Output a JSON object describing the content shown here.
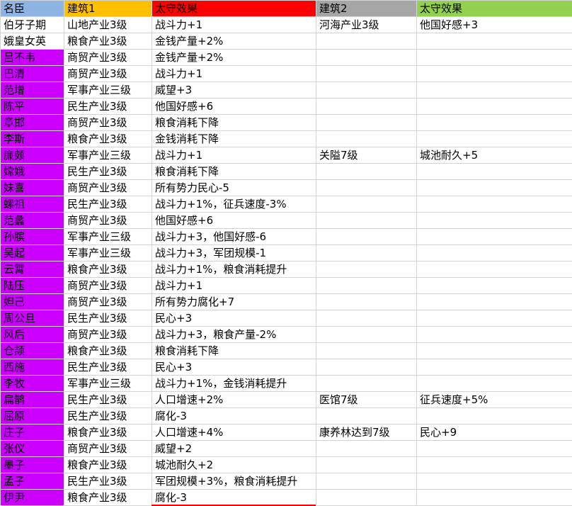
{
  "headers": [
    "名臣",
    "建筑1",
    "太守效果",
    "建筑2",
    "太守效果"
  ],
  "colors": {
    "header_name": "#8db4e2",
    "header_building1": "#ffc000",
    "header_effect1": "#ff0000",
    "header_building2": "#a6a6a6",
    "header_effect2": "#92d050",
    "name_highlight": "#cc00ff"
  },
  "rows": [
    {
      "name": "伯牙子期",
      "b1": "山地产业3级",
      "e1": "战斗力+1",
      "b2": "河海产业3级",
      "e2": "他国好感+3"
    },
    {
      "name": "娥皇女英",
      "b1": "粮食产业3级",
      "e1": "金钱产量+2%",
      "b2": "",
      "e2": ""
    },
    {
      "name": "吕不韦",
      "b1": "商贸产业3级",
      "e1": "金钱产量+2%",
      "b2": "",
      "e2": ""
    },
    {
      "name": "巴清",
      "b1": "商贸产业3级",
      "e1": "战斗力+1",
      "b2": "",
      "e2": ""
    },
    {
      "name": "范增",
      "b1": "军事产业三级",
      "e1": "威望+3",
      "b2": "",
      "e2": ""
    },
    {
      "name": "陈平",
      "b1": "民生产业3级",
      "e1": "他国好感+6",
      "b2": "",
      "e2": ""
    },
    {
      "name": "章邯",
      "b1": "商贸产业3级",
      "e1": "粮食消耗下降",
      "b2": "",
      "e2": ""
    },
    {
      "name": "李斯",
      "b1": "粮食产业3级",
      "e1": "金钱消耗下降",
      "b2": "",
      "e2": ""
    },
    {
      "name": "廉颇",
      "b1": "军事产业三级",
      "e1": "战斗力+1",
      "b2": "关隘7级",
      "e2": "城池耐久+5"
    },
    {
      "name": "嫦娥",
      "b1": "民生产业3级",
      "e1": "粮食消耗下降",
      "b2": "",
      "e2": ""
    },
    {
      "name": "妹喜",
      "b1": "商贸产业3级",
      "e1": "所有势力民心-5",
      "b2": "",
      "e2": ""
    },
    {
      "name": "螺祖",
      "b1": "民生产业3级",
      "e1": "战斗力+1%，征兵速度-3%",
      "b2": "",
      "e2": ""
    },
    {
      "name": "范蠡",
      "b1": "商贸产业3级",
      "e1": "他国好感+6",
      "b2": "",
      "e2": ""
    },
    {
      "name": "孙膑",
      "b1": "军事产业三级",
      "e1": "战斗力+3，他国好感-6",
      "b2": "",
      "e2": ""
    },
    {
      "name": "吴起",
      "b1": "军事产业三级",
      "e1": "战斗力+3，军团规模-1",
      "b2": "",
      "e2": ""
    },
    {
      "name": "云霄",
      "b1": "粮食产业3级",
      "e1": "战斗力+1%，粮食消耗提升",
      "b2": "",
      "e2": ""
    },
    {
      "name": "陆压",
      "b1": "商贸产业3级",
      "e1": "战斗力+1",
      "b2": "",
      "e2": ""
    },
    {
      "name": "妲己",
      "b1": "商贸产业3级",
      "e1": "所有势力腐化+7",
      "b2": "",
      "e2": ""
    },
    {
      "name": "周公旦",
      "b1": "民生产业3级",
      "e1": "民心+3",
      "b2": "",
      "e2": ""
    },
    {
      "name": "风后",
      "b1": "商贸产业3级",
      "e1": "战斗力+3，粮食产量-2%",
      "b2": "",
      "e2": ""
    },
    {
      "name": "仓颉",
      "b1": "粮食产业3级",
      "e1": "粮食消耗下降",
      "b2": "",
      "e2": ""
    },
    {
      "name": "西施",
      "b1": "民生产业3级",
      "e1": "民心+3",
      "b2": "",
      "e2": ""
    },
    {
      "name": "李牧",
      "b1": "军事产业三级",
      "e1": "战斗力+1%，金钱消耗提升",
      "b2": "",
      "e2": ""
    },
    {
      "name": "扁鹊",
      "b1": "民生产业3级",
      "e1": "人口增速+2%",
      "b2": "医馆7级",
      "e2": "征兵速度+5%"
    },
    {
      "name": "屈原",
      "b1": "民生产业3级",
      "e1": "腐化-3",
      "b2": "",
      "e2": ""
    },
    {
      "name": "庄子",
      "b1": "粮食产业3级",
      "e1": "人口增速+4%",
      "b2": "康养林达到7级",
      "e2": "民心+9"
    },
    {
      "name": "张仪",
      "b1": "商贸产业3级",
      "e1": "威望+2",
      "b2": "",
      "e2": ""
    },
    {
      "name": "墨子",
      "b1": "粮食产业3级",
      "e1": "城池耐久+2",
      "b2": "",
      "e2": ""
    },
    {
      "name": "孟子",
      "b1": "民生产业3级",
      "e1": "军团规模+3%，粮食消耗提升",
      "b2": "",
      "e2": ""
    },
    {
      "name": "伊尹",
      "b1": "粮食产业3级",
      "e1": "腐化-3",
      "b2": "",
      "e2": ""
    }
  ]
}
